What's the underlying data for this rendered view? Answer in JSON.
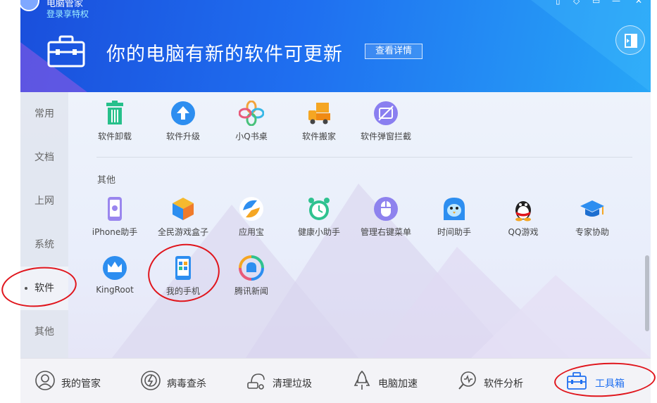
{
  "header": {
    "app_title": "电脑管家",
    "login_text": "登录享特权",
    "headline": "你的电脑有新的软件可更新",
    "details_button": "查看详情",
    "back_icon": "exit-toolbox-icon",
    "colors": {
      "header_start": "#1a4fdc",
      "header_end": "#27a6f7"
    }
  },
  "sidebar": {
    "items": [
      {
        "label": "常用"
      },
      {
        "label": "文档"
      },
      {
        "label": "上网"
      },
      {
        "label": "系统"
      },
      {
        "label": "软件"
      },
      {
        "label": "其他"
      }
    ],
    "active": "软件"
  },
  "software_tools": [
    {
      "label": "软件卸载",
      "icon": "trash-icon"
    },
    {
      "label": "软件升级",
      "icon": "upgrade-arrow-icon"
    },
    {
      "label": "小Q书桌",
      "icon": "clover-icon"
    },
    {
      "label": "软件搬家",
      "icon": "moving-truck-icon"
    },
    {
      "label": "软件弹窗拦截",
      "icon": "popup-block-icon"
    }
  ],
  "other_section": {
    "title": "其他",
    "tools": [
      {
        "label": "iPhone助手",
        "icon": "iphone-icon"
      },
      {
        "label": "全民游戏盒子",
        "icon": "game-cube-icon"
      },
      {
        "label": "应用宝",
        "icon": "app-treasure-icon"
      },
      {
        "label": "健康小助手",
        "icon": "alarm-clock-icon"
      },
      {
        "label": "管理右键菜单",
        "icon": "mouse-icon"
      },
      {
        "label": "时间助手",
        "icon": "bird-icon"
      },
      {
        "label": "QQ游戏",
        "icon": "qq-penguin-icon"
      },
      {
        "label": "专家协助",
        "icon": "graduation-cap-icon"
      },
      {
        "label": "KingRoot",
        "icon": "crown-icon"
      },
      {
        "label": "我的手机",
        "icon": "phone-icon"
      },
      {
        "label": "腾讯新闻",
        "icon": "news-bell-icon"
      }
    ]
  },
  "bottom_nav": [
    {
      "label": "我的管家",
      "icon": "butler-icon"
    },
    {
      "label": "病毒查杀",
      "icon": "virus-scan-icon"
    },
    {
      "label": "清理垃圾",
      "icon": "vacuum-icon"
    },
    {
      "label": "电脑加速",
      "icon": "rocket-icon"
    },
    {
      "label": "软件分析",
      "icon": "analysis-icon"
    },
    {
      "label": "工具箱",
      "icon": "toolbox-icon"
    }
  ]
}
